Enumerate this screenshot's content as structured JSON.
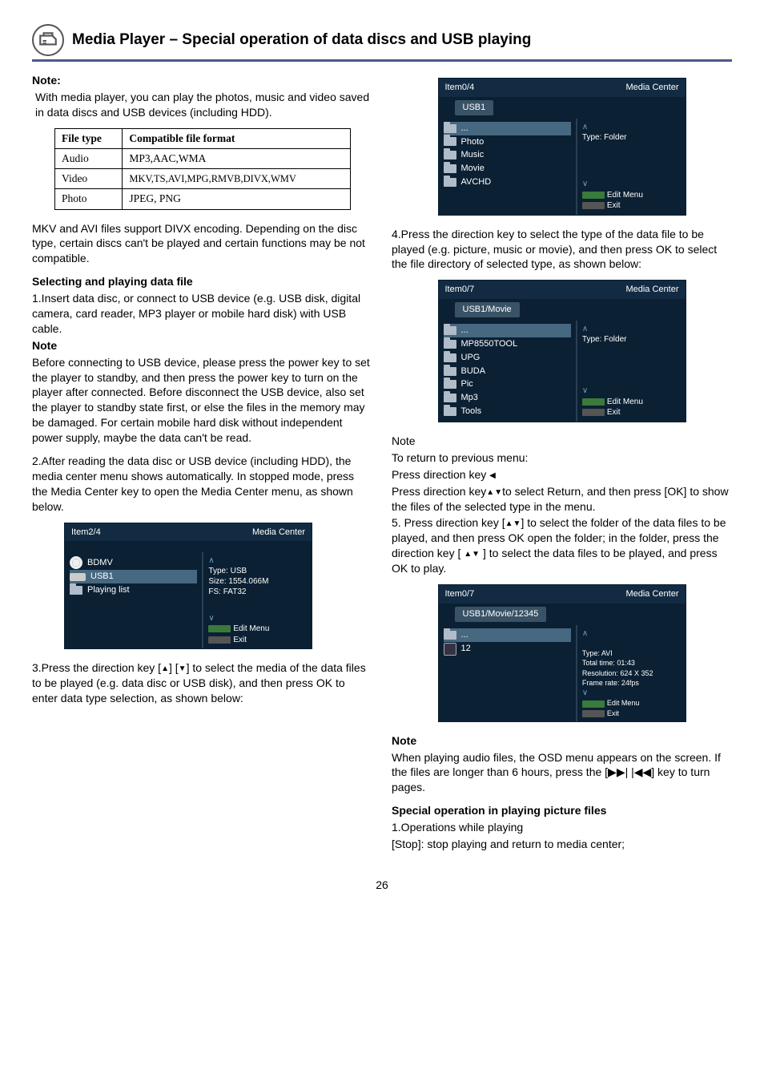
{
  "header": {
    "title": "Media Player – Special operation of data discs and USB playing"
  },
  "left": {
    "note_label": "Note:",
    "note_body": "With media player, you can play the photos, music and video saved in data discs and USB devices (including HDD).",
    "table": {
      "head": [
        "File type",
        "Compatible file format"
      ],
      "rows": [
        [
          "Audio",
          "MP3,AAC,WMA"
        ],
        [
          "Video",
          "MKV,TS,AVI,MPG,RMVB,DIVX,WMV"
        ],
        [
          "Photo",
          "JPEG, PNG"
        ]
      ]
    },
    "mkv_para": "MKV and AVI files support DIVX encoding. Depending on the disc type, certain discs can't be played and certain functions may be not compatible.",
    "select_head": "Selecting and playing data file",
    "step1": "1.Insert data disc, or connect to USB device (e.g. USB disk, digital camera, card reader, MP3 player or mobile hard disk) with USB cable.",
    "note2_label": "Note",
    "note2_body": "Before connecting to USB device, please press the power key to set the player to standby, and then press the power key to turn on the player after connected. Before disconnect the USB device, also set the player to standby state first, or else the files in the memory may be damaged. For certain mobile hard disk without independent power supply, maybe the data can't be read.",
    "step2": "2.After reading the data disc or USB device (including HDD), the media center menu shows automatically. In stopped mode, press the Media Center key to open the Media Center menu, as shown below.",
    "step3_a": "3.Press the direction key [",
    "step3_b": "] [",
    "step3_c": "] to select the media of the data files to be played (e.g. data disc or USB disk), and then press OK to enter data type selection, as shown below:"
  },
  "right": {
    "step4": "4.Press the direction key to select the type of the data file to be played (e.g. picture, music or movie), and then press OK to select the file directory of selected type, as shown below:",
    "note3_label": "Note",
    "note3_body1": "To return to previous menu:",
    "note3_body2a": "Press direction key ",
    "note3_body2b": "",
    "note3_body3a": "Press direction key",
    "note3_body3b": "to select Return, and then press [OK] to show the files of the selected type in the menu.",
    "step5a": "5. Press direction key [",
    "step5b": "] to select the folder of the data files to be played, and then press OK open the folder; in the folder, press the direction key [",
    "step5c": "] to select the data files to be played, and press OK to play.",
    "note4_label": "Note",
    "note4_body_a": "When playing audio files, the OSD menu appears on the screen. If the files are longer than 6 hours, press the [",
    "note4_body_b": "] key to turn pages.",
    "special_head": "Special operation in playing picture files",
    "special_1": "1.Operations while playing",
    "special_2": "[Stop]: stop playing and return to media center;"
  },
  "mc1": {
    "top_left": "Item2/4",
    "top_right": "Media Center",
    "items": [
      "BDMV",
      "USB1",
      "Playing list"
    ],
    "side": {
      "type": "Type: USB",
      "size": "Size: 1554.066M",
      "fs": "FS: FAT32"
    },
    "edit": "Edit Menu",
    "exit": "Exit"
  },
  "mc2": {
    "top_left": "Item0/4",
    "top_right": "Media Center",
    "bread": "USB1",
    "items": [
      "...",
      "Photo",
      "Music",
      "Movie",
      "AVCHD"
    ],
    "side": {
      "type": "Type: Folder"
    },
    "edit": "Edit Menu",
    "exit": "Exit"
  },
  "mc3": {
    "top_left": "Item0/7",
    "top_right": "Media Center",
    "bread": "USB1/Movie",
    "items": [
      "...",
      "MP8550TOOL",
      "UPG",
      "BUDA",
      "Pic",
      "Mp3",
      "Tools"
    ],
    "side": {
      "type": "Type: Folder"
    },
    "edit": "Edit Menu",
    "exit": "Exit"
  },
  "mc4": {
    "top_left": "Item0/7",
    "top_right": "Media Center",
    "bread": "USB1/Movie/12345",
    "items": [
      "...",
      "12"
    ],
    "side": {
      "l1": "Type: AVI",
      "l2": "Total time: 01:43",
      "l3": "Resolution: 624 X 352",
      "l4": "Frame rate: 24fps"
    },
    "edit": "Edit Menu",
    "exit": "Exit"
  },
  "page": "26",
  "chart_data": {
    "type": "table",
    "title": "Compatible file formats by file type",
    "columns": [
      "File type",
      "Compatible file format"
    ],
    "rows": [
      [
        "Audio",
        "MP3,AAC,WMA"
      ],
      [
        "Video",
        "MKV,TS,AVI,MPG,RMVB,DIVX,WMV"
      ],
      [
        "Photo",
        "JPEG, PNG"
      ]
    ]
  }
}
